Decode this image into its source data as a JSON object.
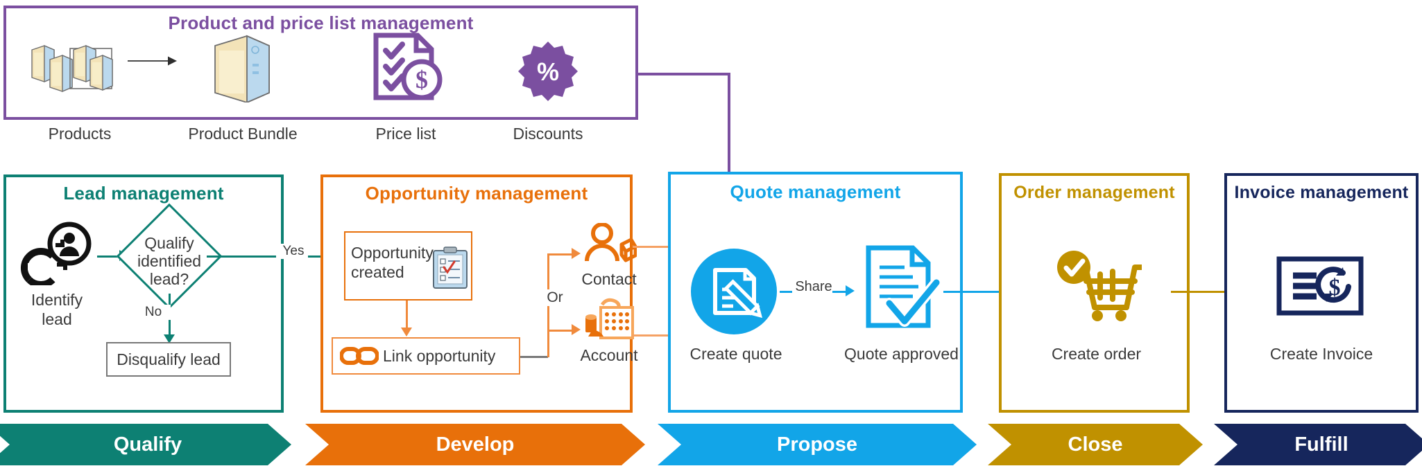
{
  "diagram": {
    "title_hidden": "",
    "colors": {
      "purple": "#7B4FA0",
      "teal": "#0D8073",
      "orange": "#E8700A",
      "blue": "#12A5E8",
      "gold": "#C09100",
      "navy": "#16265C",
      "gray_line": "#6E6E6E",
      "text": "#3A3A3A"
    }
  },
  "product_section": {
    "title": "Product and price list management",
    "items": [
      {
        "label": "Products",
        "icon": "products-icon"
      },
      {
        "label": "Product Bundle",
        "icon": "product-bundle-icon"
      },
      {
        "label": "Price list",
        "icon": "price-list-icon"
      },
      {
        "label": "Discounts",
        "icon": "discount-percent-icon"
      }
    ]
  },
  "lead_section": {
    "title": "Lead management",
    "identify_label": "Identify\nlead",
    "identify_label_line1": "Identify",
    "identify_label_line2": "lead",
    "decision_line1": "Qualify",
    "decision_line2": "identified",
    "decision_line3": "lead?",
    "yes_label": "Yes",
    "no_label": "No",
    "disqualify_label": "Disqualify lead"
  },
  "opportunity_section": {
    "title": "Opportunity management",
    "created_line1": "Opportunity",
    "created_line2": "created",
    "link_label": "Link opportunity",
    "or_label": "Or",
    "contact_label": "Contact",
    "account_label": "Account"
  },
  "quote_section": {
    "title": "Quote management",
    "create_quote_label": "Create quote",
    "share_label": "Share",
    "quote_approved_label": "Quote approved"
  },
  "order_section": {
    "title": "Order management",
    "create_order_label": "Create order"
  },
  "invoice_section": {
    "title": "Invoice management",
    "create_invoice_label": "Create Invoice"
  },
  "stages": [
    {
      "label": "Qualify",
      "color": "#0D8073"
    },
    {
      "label": "Develop",
      "color": "#E8700A"
    },
    {
      "label": "Propose",
      "color": "#12A5E8"
    },
    {
      "label": "Close",
      "color": "#C09100"
    },
    {
      "label": "Fulfill",
      "color": "#16265C"
    }
  ]
}
